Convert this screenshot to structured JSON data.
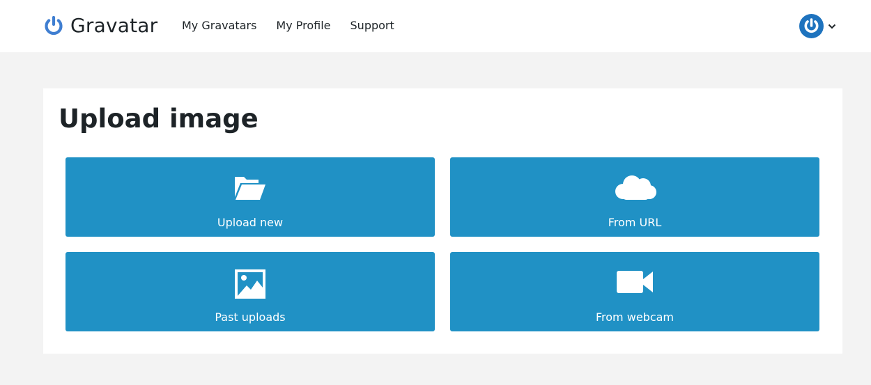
{
  "header": {
    "brand": "Gravatar",
    "nav": [
      "My Gravatars",
      "My Profile",
      "Support"
    ],
    "account_icon": "gravatar-logo-icon",
    "menu_icon": "chevron-down-icon"
  },
  "main": {
    "title": "Upload image",
    "tiles": [
      {
        "label": "Upload new",
        "icon": "folder-open-icon"
      },
      {
        "label": "From URL",
        "icon": "cloud-icon"
      },
      {
        "label": "Past uploads",
        "icon": "image-icon"
      },
      {
        "label": "From webcam",
        "icon": "video-camera-icon"
      }
    ]
  },
  "colors": {
    "brand_blue": "#1e73be",
    "tile_blue": "#2091c5",
    "page_bg": "#f3f3f3"
  }
}
